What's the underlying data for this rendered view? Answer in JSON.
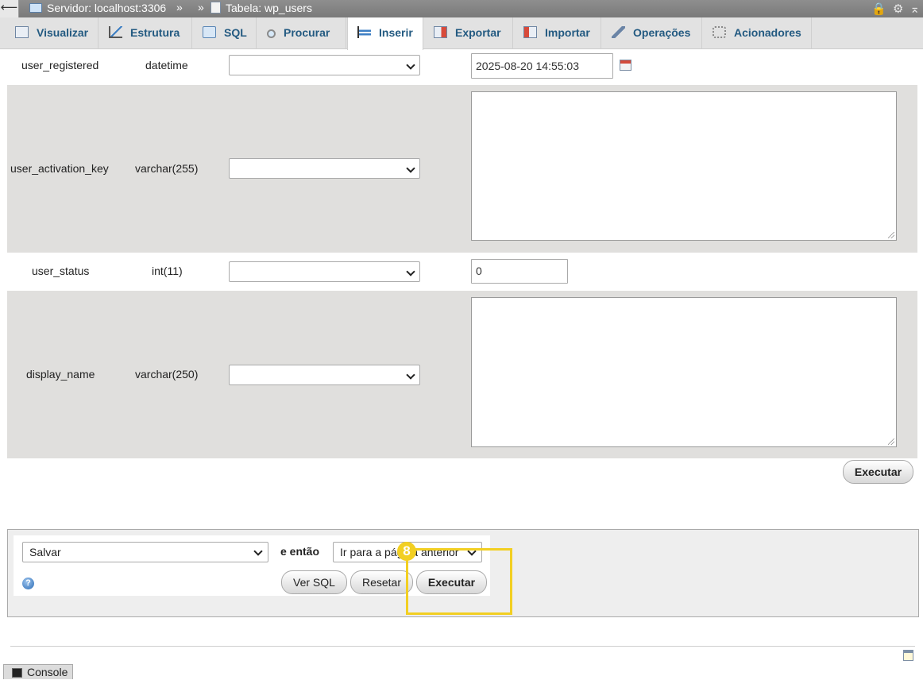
{
  "breadcrumb": {
    "back_glyph": "⟵",
    "server": "Servidor: localhost:3306",
    "sep1": "»",
    "sep2": "»",
    "table": "Tabela: wp_users"
  },
  "tabs": [
    {
      "label": "Visualizar",
      "icon": "browse-icon"
    },
    {
      "label": "Estrutura",
      "icon": "structure-icon"
    },
    {
      "label": "SQL",
      "icon": "sql-icon"
    },
    {
      "label": "Procurar",
      "icon": "search-icon"
    },
    {
      "label": "Inserir",
      "icon": "insert-icon",
      "active": true
    },
    {
      "label": "Exportar",
      "icon": "export-icon"
    },
    {
      "label": "Importar",
      "icon": "import-icon"
    },
    {
      "label": "Operações",
      "icon": "wrench-icon"
    },
    {
      "label": "Acionadores",
      "icon": "triggers-icon"
    }
  ],
  "rows": [
    {
      "column": "user_registered",
      "type": "datetime",
      "function": "",
      "value": "2025-08-20 14:55:03"
    },
    {
      "column": "user_activation_key",
      "type": "varchar(255)",
      "function": "",
      "value": ""
    },
    {
      "column": "user_status",
      "type": "int(11)",
      "function": "",
      "value": "0"
    },
    {
      "column": "display_name",
      "type": "varchar(250)",
      "function": "",
      "value": ""
    }
  ],
  "execute_label": "Executar",
  "bottom": {
    "action_select": "Salvar",
    "then_label": "e então",
    "after_select": "Ir para a página anterior",
    "help_glyph": "?",
    "preview_sql_label": "Ver SQL",
    "reset_label": "Resetar",
    "execute_label": "Executar"
  },
  "annotation": {
    "step_number": "8",
    "color": "#f2cf22"
  },
  "console_label": "Console",
  "colors": {
    "tab_text": "#235a81",
    "row_gray": "#e0dfdd",
    "topbar": "#828282"
  }
}
